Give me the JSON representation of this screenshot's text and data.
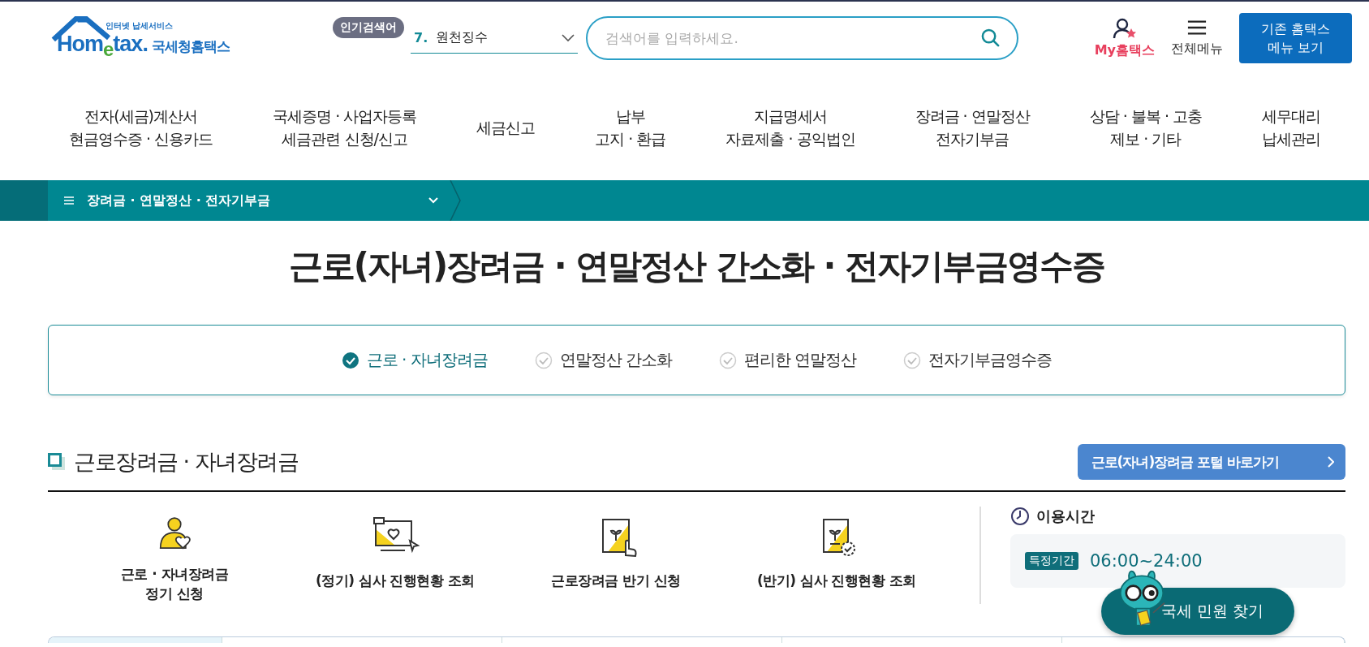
{
  "header": {
    "logo": {
      "tagline": "인터넷 납세서비스",
      "brand": "Hom$_{e}$tax.",
      "name": "국세청홈택스"
    },
    "popular_search": {
      "label": "인기검색어",
      "rank": "7.",
      "term": "원천징수"
    },
    "search": {
      "placeholder": "검색어를 입력하세요."
    },
    "my_hometax": "My홈택스",
    "all_menu": "전체메뉴",
    "legacy_button": [
      "기존 홈택스",
      "메뉴 보기"
    ]
  },
  "nav": [
    {
      "lines": [
        "전자(세금)계산서",
        "현금영수증 · 신용카드"
      ]
    },
    {
      "lines": [
        "국세증명 · 사업자등록",
        "세금관련 신청/신고"
      ]
    },
    {
      "lines": [
        "세금신고"
      ]
    },
    {
      "lines": [
        "납부",
        "고지 · 환급"
      ]
    },
    {
      "lines": [
        "지급명세서",
        "자료제출 · 공익법인"
      ]
    },
    {
      "lines": [
        "장려금 · 연말정산",
        "전자기부금"
      ]
    },
    {
      "lines": [
        "상담 · 불복 · 고충",
        "제보 · 기타"
      ]
    },
    {
      "lines": [
        "세무대리",
        "납세관리"
      ]
    }
  ],
  "breadcrumb": "장려금 · 연말정산 · 전자기부금",
  "title": "근로(자녀)장려금 · 연말정산 간소화 · 전자기부금영수증",
  "tabs": [
    {
      "label": "근로 · 자녀장려금",
      "selected": true
    },
    {
      "label": "연말정산 간소화",
      "selected": false
    },
    {
      "label": "편리한 연말정산",
      "selected": false
    },
    {
      "label": "전자기부금영수증",
      "selected": false
    }
  ],
  "section": {
    "heading": "근로장려금 · 자녀장려금",
    "portal_button": "근로(자녀)장려금 포털 바로가기",
    "services": [
      {
        "kind": "person",
        "lines": [
          "근로 · 자녀장려금",
          "정기 신청"
        ]
      },
      {
        "kind": "monitor",
        "lines": [
          "(정기) 심사 진행현황 조회"
        ]
      },
      {
        "kind": "clipboard-hand",
        "lines": [
          "근로장려금 반기 신청"
        ]
      },
      {
        "kind": "clipboard-check",
        "lines": [
          "(반기) 심사 진행현황 조회"
        ]
      }
    ],
    "hours": {
      "label": "이용시간",
      "tag": "특정기간",
      "time": "06:00~24:00"
    }
  },
  "floating_button": "국세 민원 찾기"
}
